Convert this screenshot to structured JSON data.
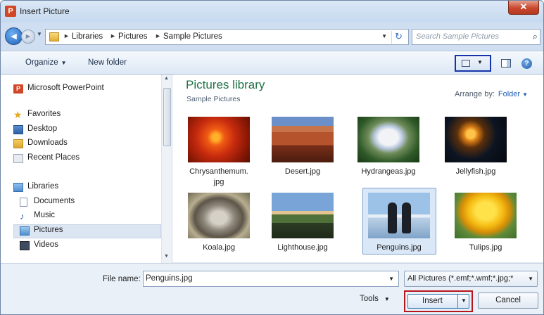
{
  "window": {
    "title": "Insert Picture",
    "app_icon_letter": "P",
    "close_glyph": "✕"
  },
  "nav": {
    "back_glyph": "◄",
    "forward_glyph": "►",
    "dropdown_glyph": "▼",
    "breadcrumbs": [
      "Libraries",
      "Pictures",
      "Sample Pictures"
    ],
    "separator": "►",
    "refresh_glyph": "↻",
    "search_placeholder": "Search Sample Pictures",
    "search_glyph": "⌕"
  },
  "toolbar": {
    "organize_label": "Organize",
    "new_folder_label": "New folder",
    "caret": "▼",
    "help_glyph": "?"
  },
  "sidebar": {
    "items": [
      {
        "label": "Microsoft PowerPoint",
        "icon": "powerpoint-icon",
        "glyph": "P"
      },
      {
        "label": "Favorites",
        "icon": "star-icon",
        "glyph": "★"
      },
      {
        "label": "Desktop",
        "icon": "desktop-icon"
      },
      {
        "label": "Downloads",
        "icon": "downloads-icon"
      },
      {
        "label": "Recent Places",
        "icon": "recent-places-icon"
      },
      {
        "label": "Libraries",
        "icon": "libraries-icon"
      },
      {
        "label": "Documents",
        "icon": "documents-icon"
      },
      {
        "label": "Music",
        "icon": "music-icon",
        "glyph": "♪"
      },
      {
        "label": "Pictures",
        "icon": "pictures-icon"
      },
      {
        "label": "Videos",
        "icon": "videos-icon"
      }
    ],
    "selected": "Pictures",
    "scroll_up": "▲",
    "scroll_down": "▼"
  },
  "content": {
    "title": "Pictures library",
    "subtitle": "Sample Pictures",
    "arrange_label": "Arrange by:",
    "arrange_value": "Folder",
    "arrange_caret": "▼",
    "files": [
      {
        "name": "Chrysanthemum.jpg",
        "line1": "Chrysanthemum.",
        "line2": "jpg"
      },
      {
        "name": "Desert.jpg"
      },
      {
        "name": "Hydrangeas.jpg"
      },
      {
        "name": "Jellyfish.jpg"
      },
      {
        "name": "Koala.jpg"
      },
      {
        "name": "Lighthouse.jpg"
      },
      {
        "name": "Penguins.jpg"
      },
      {
        "name": "Tulips.jpg"
      }
    ],
    "selected_file": "Penguins.jpg"
  },
  "footer": {
    "file_name_label": "File name:",
    "file_name_value": "Penguins.jpg",
    "file_type_value": "All Pictures (*.emf;*.wmf;*.jpg;*",
    "tools_label": "Tools",
    "insert_label": "Insert",
    "cancel_label": "Cancel",
    "caret": "▼"
  },
  "colors": {
    "highlight_view_button": "#1634a8",
    "highlight_insert_button": "#b5151c",
    "library_title": "#1e7145",
    "link_blue": "#1f5db3"
  }
}
